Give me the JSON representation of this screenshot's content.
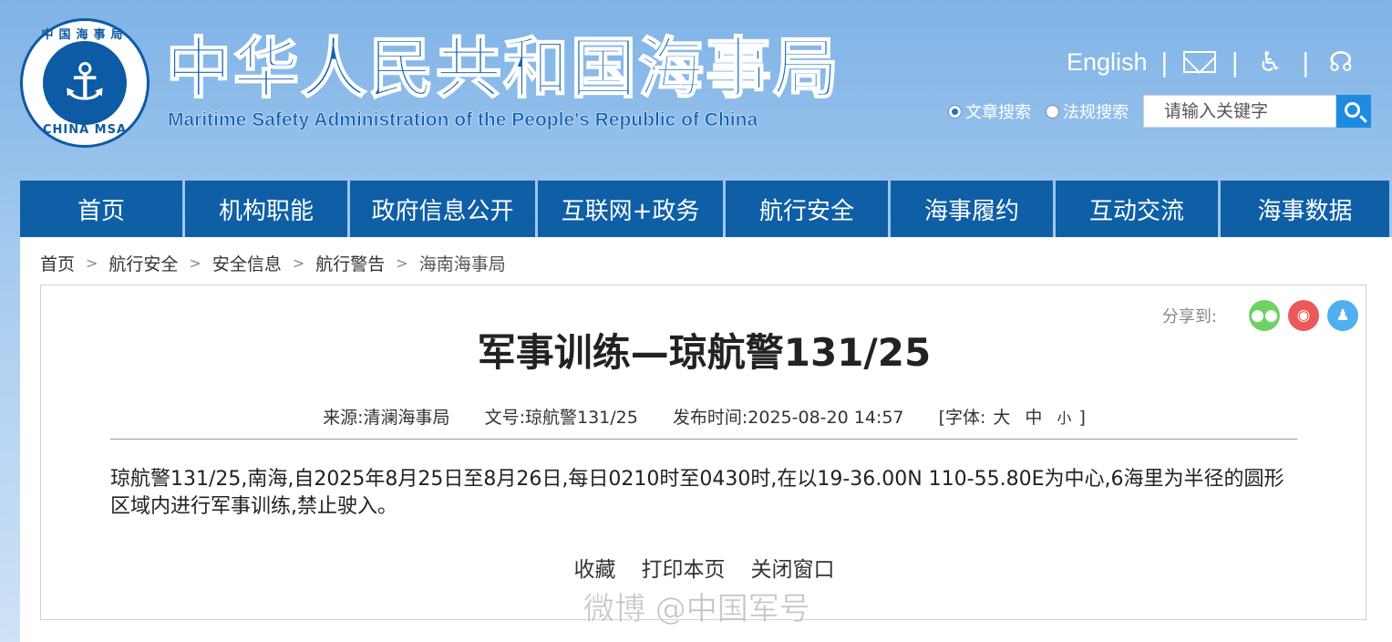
{
  "header": {
    "emblem_top": "中国海事局",
    "emblem_bottom": "CHINA MSA",
    "title": "中华人民共和国海事局",
    "subtitle": "Maritime Safety Administration of the People's Republic of China",
    "english_link": "English",
    "icons": [
      "mail-icon",
      "accessibility-icon",
      "elderly-mode-icon"
    ]
  },
  "search": {
    "radio_article": "文章搜索",
    "radio_law": "法规搜索",
    "placeholder": "请输入关键字"
  },
  "nav": [
    {
      "label": "首页"
    },
    {
      "label": "机构职能"
    },
    {
      "label": "政府信息公开"
    },
    {
      "label": "互联网+政务"
    },
    {
      "label": "航行安全"
    },
    {
      "label": "海事履约"
    },
    {
      "label": "互动交流"
    },
    {
      "label": "海事数据"
    }
  ],
  "breadcrumb": [
    "首页",
    "航行安全",
    "安全信息",
    "航行警告",
    "海南海事局"
  ],
  "share": {
    "label": "分享到:"
  },
  "article": {
    "title": "军事训练—琼航警131/25",
    "source": "来源:清澜海事局",
    "doc_no": "文号:琼航警131/25",
    "published": "发布时间:2025-08-20 14:57",
    "font_label": "[字体:",
    "font_large": "大",
    "font_medium": "中",
    "font_small": "小",
    "font_close": "]",
    "body": "琼航警131/25,南海,自2025年8月25日至8月26日,每日0210时至0430时,在以19-36.00N 110-55.80E为中心,6海里为半径的圆形区域内进行军事训练,禁止驶入。"
  },
  "actions": {
    "favorite": "收藏",
    "print": "打印本页",
    "close": "关闭窗口"
  },
  "watermark": "微博 @中国军号",
  "colors": {
    "nav_bg": "#0e5fa6",
    "title_blue": "#0f62b8",
    "search_btn": "#1f8be0"
  }
}
